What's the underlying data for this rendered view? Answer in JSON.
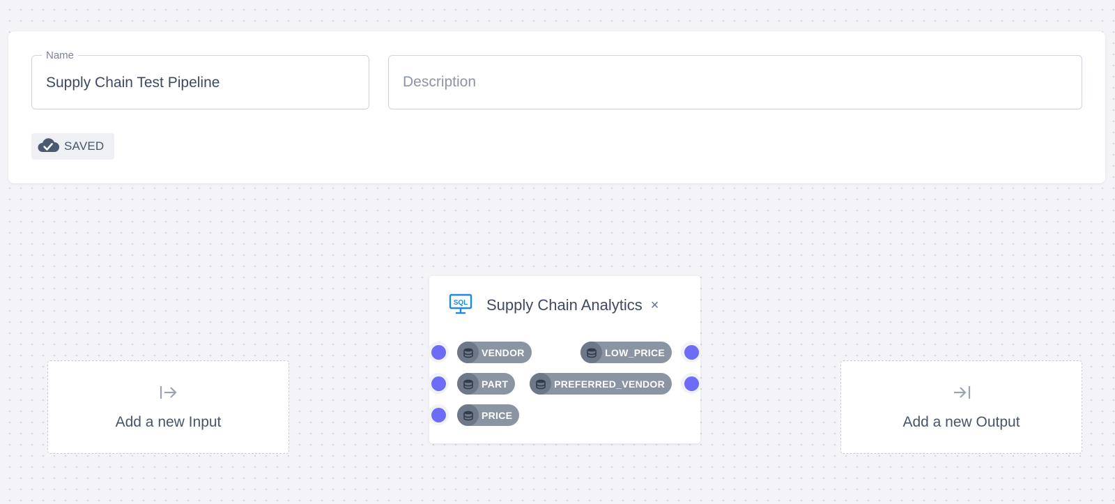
{
  "pipeline": {
    "name_label": "Name",
    "name_value": "Supply Chain Test Pipeline",
    "description_placeholder": "Description",
    "status": "SAVED",
    "status_icon": "cloud-check-icon"
  },
  "canvas": {
    "add_input": {
      "label": "Add a new Input",
      "icon": "input-arrow-icon"
    },
    "add_output": {
      "label": "Add a new Output",
      "icon": "output-arrow-icon"
    },
    "node": {
      "title": "Supply Chain Analytics",
      "icon": "sql-monitor-icon",
      "icon_text": "SQL",
      "close_symbol": "×",
      "inputs": [
        "VENDOR",
        "PART",
        "PRICE"
      ],
      "outputs": [
        "LOW_PRICE",
        "PREFERRED_VENDOR"
      ]
    }
  },
  "colors": {
    "port": "#6c6cf6",
    "pill": "#8b94a3",
    "sql_icon": "#1e88e5"
  }
}
